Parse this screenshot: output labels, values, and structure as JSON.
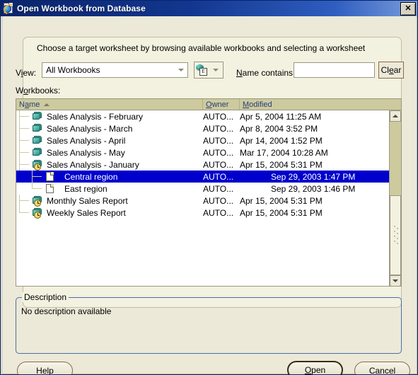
{
  "window": {
    "title": "Open Workbook from Database",
    "title_icon": "ie-document-icon",
    "close_label": "✕"
  },
  "instruction": "Choose a target worksheet by browsing available workbooks and selecting a worksheet",
  "toolbar": {
    "view_label_pre": "V",
    "view_label_mnemonic": "i",
    "view_label_post": "ew:",
    "view_value": "All Workbooks",
    "view_options": [
      "All Workbooks"
    ],
    "icon_button_name": "workbook-sphere-icon",
    "icon_badge_letter": "E",
    "name_contains_label_pre": "",
    "name_contains_label_mnemonic": "N",
    "name_contains_label_post": "ame contains:",
    "name_contains_value": "",
    "name_contains_placeholder": "",
    "clear_label_pre": "Cl",
    "clear_label_mnemonic": "e",
    "clear_label_post": "ar"
  },
  "workbooks_label_pre": "W",
  "workbooks_label_mnemonic": "o",
  "workbooks_label_post": "rkbooks:",
  "tree": {
    "columns": [
      {
        "key": "name",
        "label_pre": "N",
        "label_mnemonic": "a",
        "label_post": "me",
        "sorted": "asc"
      },
      {
        "key": "owner",
        "label_pre": "",
        "label_mnemonic": "O",
        "label_post": "wner",
        "sorted": ""
      },
      {
        "key": "modified",
        "label_pre": "",
        "label_mnemonic": "M",
        "label_post": "odified",
        "sorted": ""
      }
    ],
    "rows": [
      {
        "name": "Sales Analysis - February",
        "owner": "AUTO...",
        "modified": "Apr 5, 2004 11:25 AM",
        "icon": "workbook-book-icon",
        "level": 0,
        "selected": false,
        "last": false
      },
      {
        "name": "Sales Analysis - March",
        "owner": "AUTO...",
        "modified": "Apr 8, 2004 3:52 PM",
        "icon": "workbook-book-icon",
        "level": 0,
        "selected": false,
        "last": false
      },
      {
        "name": "Sales Analysis - April",
        "owner": "AUTO...",
        "modified": "Apr 14, 2004 1:52 PM",
        "icon": "workbook-book-icon",
        "level": 0,
        "selected": false,
        "last": false
      },
      {
        "name": "Sales Analysis - May",
        "owner": "AUTO...",
        "modified": "Mar 17, 2004 10:28 AM",
        "icon": "workbook-book-icon",
        "level": 0,
        "selected": false,
        "last": false
      },
      {
        "name": "Sales Analysis - January",
        "owner": "AUTO...",
        "modified": "Apr 15, 2004 5:31 PM",
        "icon": "workbook-clock-icon",
        "level": 0,
        "selected": false,
        "last": false
      },
      {
        "name": "Central region",
        "owner": "AUTO...",
        "modified": "Sep 29, 2003 1:47 PM",
        "icon": "worksheet-document-icon",
        "level": 1,
        "selected": true,
        "last": false
      },
      {
        "name": "East region",
        "owner": "AUTO...",
        "modified": "Sep 29, 2003 1:46 PM",
        "icon": "worksheet-document-icon",
        "level": 1,
        "selected": false,
        "last": true
      },
      {
        "name": "Monthly Sales Report",
        "owner": "AUTO...",
        "modified": "Apr 15, 2004 5:31 PM",
        "icon": "workbook-clock-icon",
        "level": 0,
        "selected": false,
        "last": false
      },
      {
        "name": "Weekly Sales Report",
        "owner": "AUTO...",
        "modified": "Apr 15, 2004 5:31 PM",
        "icon": "workbook-clock-icon",
        "level": 0,
        "selected": false,
        "last": true
      }
    ],
    "scrollbar": {
      "up_arrow": "▲",
      "down_arrow": "▼"
    }
  },
  "description": {
    "legend": "Description",
    "text": "No description available"
  },
  "buttons": {
    "help_pre": "H",
    "help_mnemonic": "e",
    "help_post": "lp",
    "open_pre": "",
    "open_mnemonic": "O",
    "open_post": "pen",
    "cancel_pre": "",
    "cancel_mnemonic": "C",
    "cancel_post": "ancel"
  },
  "colors": {
    "titlebar_start": "#0a246a",
    "titlebar_end": "#7a9ddb",
    "panel_bg": "#f3f1e0",
    "dialog_bg": "#ece9d8",
    "selection_bg": "#0000cc",
    "selection_fg": "#ffffff",
    "header_bg": "#cdca9e",
    "header_fg": "#24407a",
    "group_border": "#4a6fa5",
    "button_border": "#8a6a4a"
  }
}
